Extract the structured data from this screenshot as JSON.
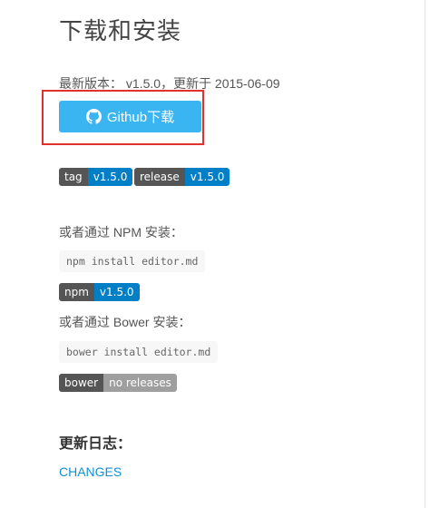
{
  "page": {
    "title": "下载和安装",
    "version_line": "最新版本： v1.5.0，更新于 2015-06-09"
  },
  "github_button": {
    "label": "Github下载",
    "icon": "github-icon"
  },
  "badges": {
    "tag": {
      "left": "tag",
      "right": "v1.5.0"
    },
    "release": {
      "left": "release",
      "right": "v1.5.0"
    },
    "npm": {
      "left": "npm",
      "right": "v1.5.0"
    },
    "bower": {
      "left": "bower",
      "right": "no releases"
    }
  },
  "npm": {
    "intro": "或者通过 NPM 安装：",
    "command": "npm install editor.md"
  },
  "bower": {
    "intro": "或者通过 Bower 安装：",
    "command": "bower install editor.md"
  },
  "changelog": {
    "heading": "更新日志：",
    "link": "CHANGES"
  },
  "colors": {
    "button_blue": "#3bb4f2",
    "badge_dark": "#555555",
    "badge_blue": "#007ec6",
    "badge_grey": "#9f9f9f",
    "highlight_red": "#e03131",
    "link_blue": "#0e90d2"
  }
}
